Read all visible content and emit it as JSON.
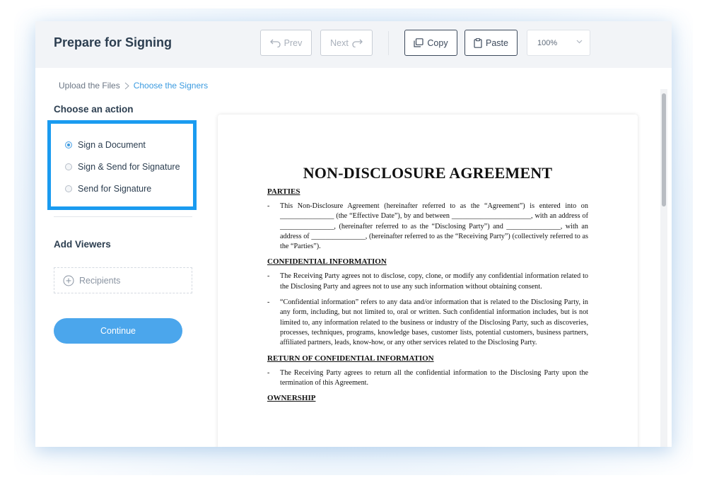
{
  "header": {
    "title": "Prepare for Signing",
    "prev_label": "Prev",
    "next_label": "Next",
    "copy_label": "Copy",
    "paste_label": "Paste",
    "zoom_value": "100%"
  },
  "breadcrumb": {
    "step1": "Upload the Files",
    "step2": "Choose the Signers"
  },
  "sidebar": {
    "action_title": "Choose an action",
    "actions": [
      {
        "label": "Sign a Document",
        "selected": true
      },
      {
        "label": "Sign & Send for Signature",
        "selected": false
      },
      {
        "label": "Send for Signature",
        "selected": false
      }
    ],
    "viewers_title": "Add Viewers",
    "recipients_label": "Recipients",
    "continue_label": "Continue"
  },
  "colors": {
    "accent": "#3b9be0",
    "highlight": "#1a9bf0",
    "continue_bg": "#4ba6ec"
  },
  "document": {
    "title": "NON-DISCLOSURE AGREEMENT",
    "sections": [
      {
        "heading": "PARTIES",
        "paragraphs": [
          "This Non-Disclosure Agreement (hereinafter referred to as the “Agreement”) is entered into on _______________ (the “Effective Date”), by and between ______________________, with an address of _______________, (hereinafter referred to as the “Disclosing Party”) and _______________, with an address of _______________, (hereinafter referred to as the “Receiving Party”) (collectively referred to as the “Parties”)."
        ]
      },
      {
        "heading": "CONFIDENTIAL INFORMATION",
        "paragraphs": [
          "The Receiving Party agrees not to disclose, copy, clone, or modify any confidential information related to the Disclosing Party and agrees not to use any such information without obtaining consent.",
          "“Confidential information” refers to any data and/or information that is related to the Disclosing Party, in any form, including, but not limited to, oral or written. Such confidential information includes, but is not limited to, any information related to the business or industry of the Disclosing Party, such as discoveries, processes, techniques, programs, knowledge bases, customer lists, potential customers, business partners, affiliated partners, leads, know-how, or any other services related to the Disclosing Party."
        ]
      },
      {
        "heading": "RETURN OF CONFIDENTIAL INFORMATION",
        "paragraphs": [
          "The Receiving Party agrees to return all the confidential information to the Disclosing Party upon the termination of this Agreement."
        ]
      },
      {
        "heading": "OWNERSHIP",
        "paragraphs": []
      }
    ]
  }
}
